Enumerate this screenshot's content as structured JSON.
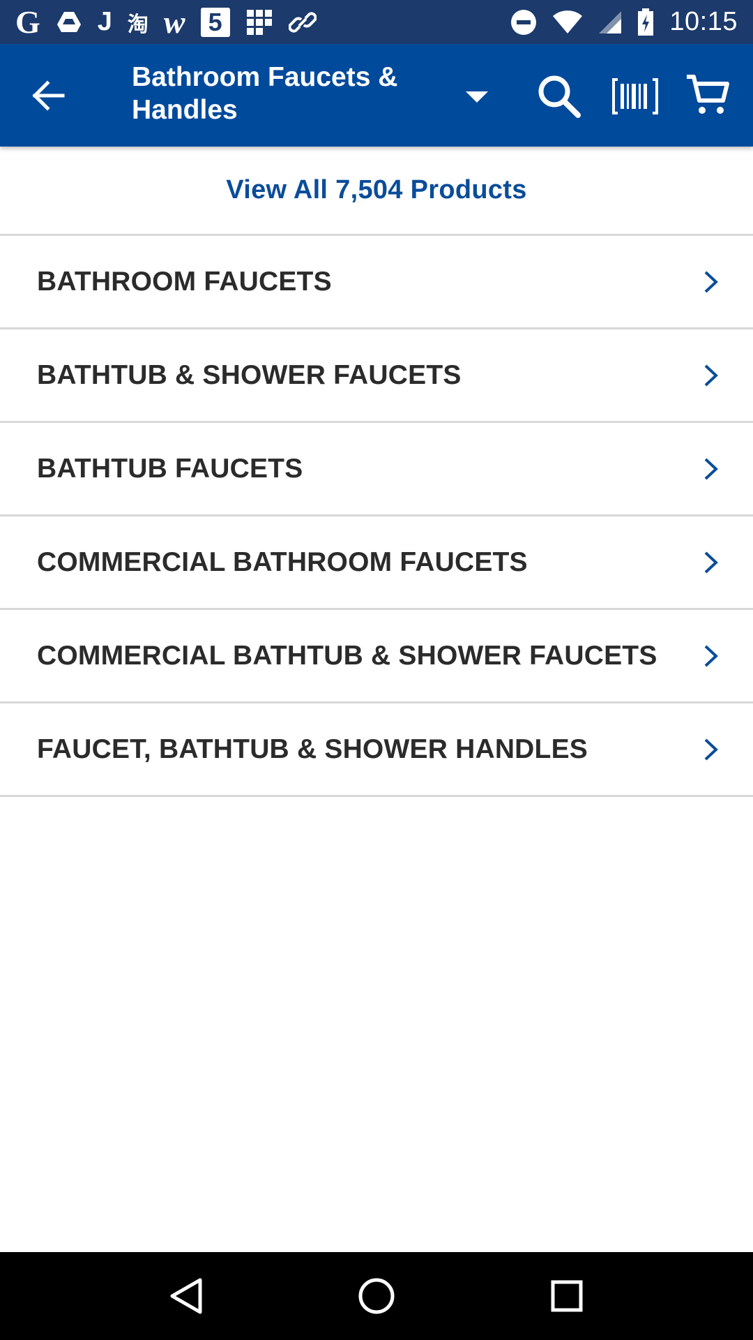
{
  "status_bar": {
    "time": "10:15",
    "left_icons": [
      "google-icon",
      "drive-icon",
      "j-app-icon",
      "taobao-icon",
      "w-app-icon",
      "five-app-icon",
      "grid-app-icon",
      "link-app-icon"
    ],
    "right_icons": [
      "do-not-disturb-icon",
      "wifi-icon",
      "signal-icon",
      "battery-charging-icon"
    ],
    "labels": {
      "google": "G",
      "j_app": "J",
      "taobao": "淘",
      "w_app": "w",
      "five_app": "5"
    }
  },
  "app_bar": {
    "title": "Bathroom Faucets & Handles",
    "background": "#004a9c"
  },
  "view_all": {
    "label": "View All 7,504 Products",
    "color": "#0a4d99"
  },
  "categories": [
    {
      "label": "BATHROOM FAUCETS"
    },
    {
      "label": "BATHTUB & SHOWER FAUCETS"
    },
    {
      "label": "BATHTUB FAUCETS"
    },
    {
      "label": "COMMERCIAL BATHROOM FAUCETS"
    },
    {
      "label": "COMMERCIAL BATHTUB & SHOWER FAUCETS"
    },
    {
      "label": "FAUCET, BATHTUB & SHOWER HANDLES"
    }
  ],
  "nav_bar": {
    "buttons": [
      "back-triangle-icon",
      "home-circle-icon",
      "recents-square-icon"
    ]
  }
}
